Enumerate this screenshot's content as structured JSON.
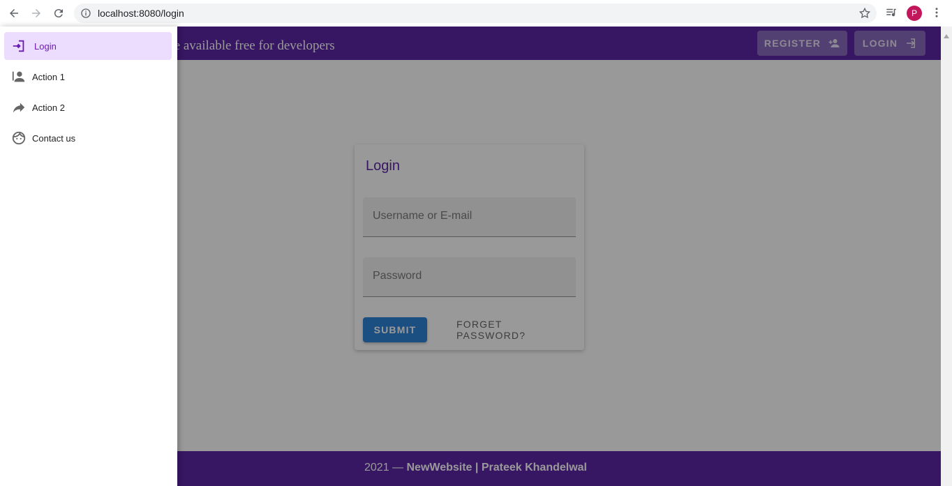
{
  "browser": {
    "url": "localhost:8080/login",
    "profile_initial": "P"
  },
  "appbar": {
    "title": "A free theme available free for developers",
    "register_label": "REGISTER",
    "login_label": "LOGIN"
  },
  "drawer": {
    "items": [
      {
        "label": "Login",
        "icon": "login-icon",
        "active": true
      },
      {
        "label": "Action 1",
        "icon": "user-icon"
      },
      {
        "label": "Action 2",
        "icon": "share-arrow-icon"
      },
      {
        "label": "Contact us",
        "icon": "face-icon"
      }
    ]
  },
  "login": {
    "title": "Login",
    "username_placeholder": "Username or E-mail",
    "password_placeholder": "Password",
    "submit_label": "SUBMIT",
    "forget_label": "FORGET PASSWORD?"
  },
  "footer": {
    "year": "2021 —",
    "site": "NewWebsite | Prateek Khandelwal"
  },
  "colors": {
    "primary": "#4a0e9c",
    "accent": "#1976d2",
    "drawer_active": "#ecdcfd"
  }
}
